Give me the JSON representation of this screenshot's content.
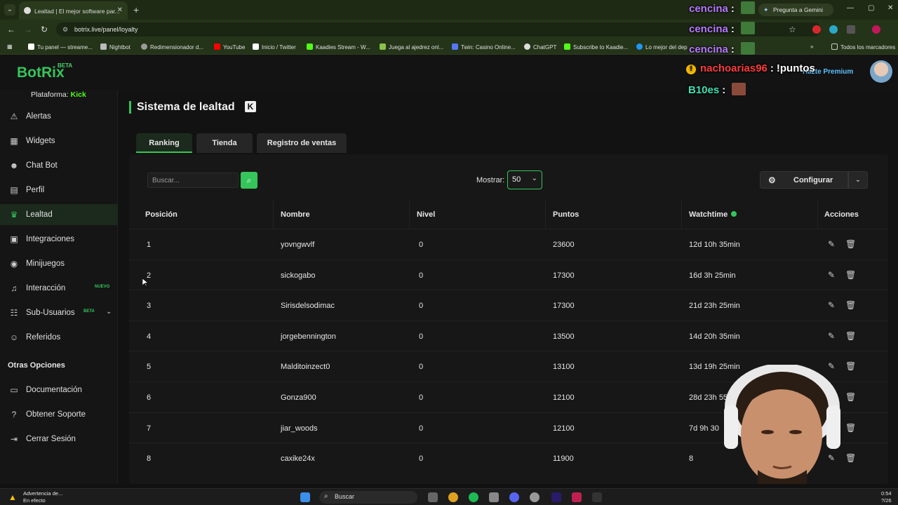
{
  "browser": {
    "tab_title": "Lealtad | El mejor software par...",
    "url": "botrix.live/panel/loyalty",
    "gemini_label": "Pregunta a Gemini",
    "bookmarks": [
      "Tu panel — streame...",
      "Nightbot",
      "Redimensionador d...",
      "YouTube",
      "Inicio / Twitter",
      "Kaadies Stream - W...",
      "Juega al ajedrez onl...",
      "Twin: Casino Online...",
      "ChatGPT",
      "Subscribe to Kaadie...",
      "Lo mejor del dep"
    ],
    "bookmarks_all": "Todos los marcadores"
  },
  "header": {
    "logo": "BotRix",
    "logo_badge": "BETA",
    "premium": "Hazte Premium"
  },
  "overlay_chat": [
    {
      "user": "cencina",
      "sep": ":",
      "msg": "",
      "color": "#b77bff"
    },
    {
      "user": "cencina",
      "sep": ":",
      "msg": "",
      "color": "#b77bff"
    },
    {
      "user": "cencina",
      "sep": ":",
      "msg": "",
      "color": "#b77bff"
    },
    {
      "user": "nachoarias96",
      "sep": ":",
      "msg": "!puntos",
      "color": "#ff3b3b"
    },
    {
      "user": "B10es",
      "sep": ":",
      "msg": "",
      "color": "#3fe0b0"
    }
  ],
  "sidebar": {
    "platform_label": "Plataforma:",
    "platform_value": "Kick",
    "items": [
      {
        "label": "Alertas",
        "icon": "⚠",
        "name": "alerts-icon"
      },
      {
        "label": "Widgets",
        "icon": "▦",
        "name": "widgets-icon"
      },
      {
        "label": "Chat Bot",
        "icon": "☻",
        "name": "robot-icon"
      },
      {
        "label": "Perfil",
        "icon": "▤",
        "name": "profile-icon"
      },
      {
        "label": "Lealtad",
        "icon": "♛",
        "name": "trophy-icon"
      },
      {
        "label": "Integraciones",
        "icon": "▣",
        "name": "integrations-icon"
      },
      {
        "label": "Minijuegos",
        "icon": "◉",
        "name": "gamepad-icon"
      },
      {
        "label": "Interacción",
        "icon": "♫",
        "name": "music-icon",
        "badge": "NUEVO"
      },
      {
        "label": "Sub-Usuarios",
        "icon": "☷",
        "name": "users-icon",
        "badge": "BETA"
      },
      {
        "label": "Referidos",
        "icon": "☺",
        "name": "referrals-icon"
      }
    ],
    "section_title": "Otras Opciones",
    "other_items": [
      {
        "label": "Documentación",
        "icon": "▭",
        "name": "docs-icon"
      },
      {
        "label": "Obtener Soporte",
        "icon": "?",
        "name": "support-icon"
      },
      {
        "label": "Cerrar Sesión",
        "icon": "⇥",
        "name": "logout-icon"
      }
    ]
  },
  "main": {
    "title": "Sistema de lealtad",
    "tabs": [
      "Ranking",
      "Tienda",
      "Registro de ventas"
    ],
    "search_placeholder": "Buscar...",
    "show_label": "Mostrar:",
    "show_value": "50",
    "config_label": "Configurar",
    "columns": [
      "Posición",
      "Nombre",
      "Nivel",
      "Puntos",
      "Watchtime",
      "Acciones"
    ],
    "rows": [
      {
        "pos": "1",
        "name": "yovngwvlf",
        "level": "0",
        "points": "23600",
        "watch": "12d 10h 35min"
      },
      {
        "pos": "2",
        "name": "sickogabo",
        "level": "0",
        "points": "17300",
        "watch": "16d 3h 25min"
      },
      {
        "pos": "3",
        "name": "Sirisdelsodimac",
        "level": "0",
        "points": "17300",
        "watch": "21d 23h 25min"
      },
      {
        "pos": "4",
        "name": "jorgebennington",
        "level": "0",
        "points": "13500",
        "watch": "14d 20h 35min"
      },
      {
        "pos": "5",
        "name": "Malditoinzect0",
        "level": "0",
        "points": "13100",
        "watch": "13d 19h 25min"
      },
      {
        "pos": "6",
        "name": "Gonza900",
        "level": "0",
        "points": "12100",
        "watch": "28d 23h 55m"
      },
      {
        "pos": "7",
        "name": "jiar_woods",
        "level": "0",
        "points": "12100",
        "watch": "7d 9h 30"
      },
      {
        "pos": "8",
        "name": "caxike24x",
        "level": "0",
        "points": "11900",
        "watch": "8"
      }
    ]
  },
  "taskbar": {
    "warning_title": "Advertencia de...",
    "warning_sub": "En efecto",
    "search": "Buscar",
    "time": "0:54",
    "date": "?/26"
  }
}
